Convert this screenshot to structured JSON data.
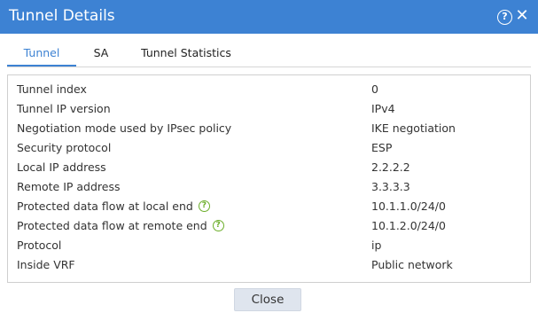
{
  "dialog": {
    "title": "Tunnel Details",
    "help_glyph": "?",
    "close_glyph": "✕"
  },
  "tabs": [
    {
      "label": "Tunnel",
      "active": true
    },
    {
      "label": "SA",
      "active": false
    },
    {
      "label": "Tunnel Statistics",
      "active": false
    }
  ],
  "fields": [
    {
      "label": "Tunnel index",
      "value": "0"
    },
    {
      "label": "Tunnel IP version",
      "value": "IPv4"
    },
    {
      "label": "Negotiation mode used by IPsec policy",
      "value": "IKE negotiation"
    },
    {
      "label": "Security protocol",
      "value": "ESP"
    },
    {
      "label": "Local IP address",
      "value": "2.2.2.2"
    },
    {
      "label": "Remote IP address",
      "value": "3.3.3.3"
    },
    {
      "label": "Protected data flow at local end",
      "value": "10.1.1.0/24/0",
      "help": true
    },
    {
      "label": "Protected data flow at remote end",
      "value": "10.1.2.0/24/0",
      "help": true
    },
    {
      "label": "Protocol",
      "value": "ip"
    },
    {
      "label": "Inside VRF",
      "value": "Public network"
    }
  ],
  "help_icon_glyph": "?",
  "footer": {
    "close_label": "Close"
  },
  "colors": {
    "titlebar": "#3d82d3",
    "tab_active": "#3d82d3",
    "help_icon": "#6cae2a",
    "button_bg": "#dfe5ee"
  }
}
